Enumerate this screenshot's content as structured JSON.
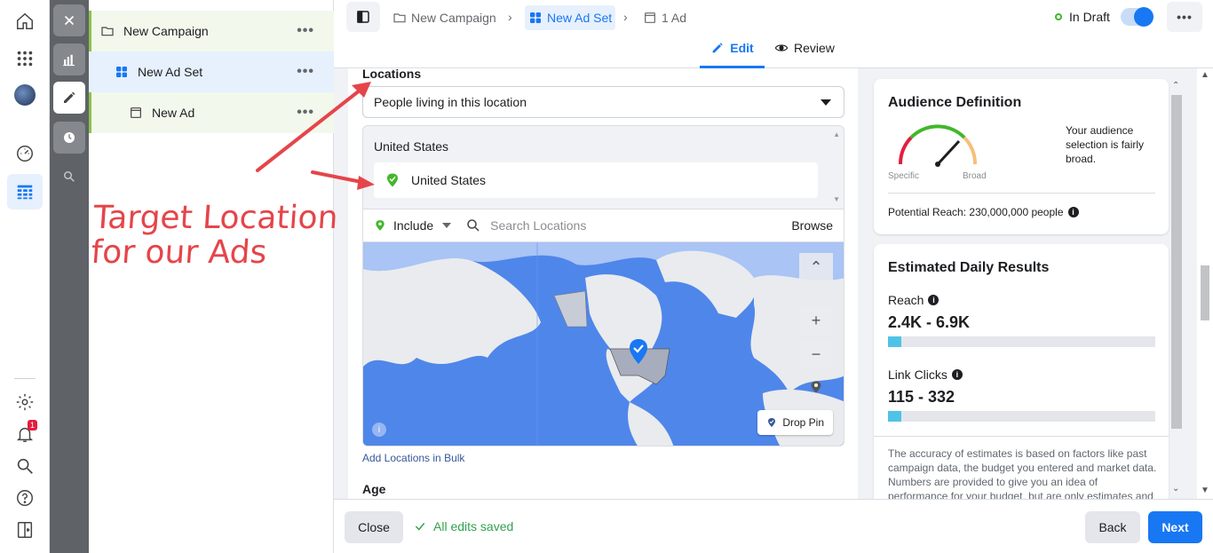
{
  "tree": {
    "campaign": "New Campaign",
    "adset": "New Ad Set",
    "ad": "New Ad",
    "more": "•••"
  },
  "breadcrumb": {
    "campaign": "New Campaign",
    "adset": "New Ad Set",
    "ad": "1 Ad"
  },
  "header": {
    "status": "In Draft",
    "tabs": {
      "edit": "Edit",
      "review": "Review"
    },
    "more": "•••"
  },
  "notifications": {
    "count": "1"
  },
  "locations": {
    "title": "Locations",
    "select_value": "People living in this location",
    "group_heading": "United States",
    "selected": [
      "United States"
    ],
    "include_label": "Include",
    "search_placeholder": "Search Locations",
    "browse": "Browse",
    "drop_pin": "Drop Pin",
    "bulk_link": "Add Locations in Bulk"
  },
  "age": {
    "title": "Age"
  },
  "audience": {
    "title": "Audience Definition",
    "gauge_left": "Specific",
    "gauge_right": "Broad",
    "description": "Your audience selection is fairly broad.",
    "potential_reach": "Potential Reach: 230,000,000 people"
  },
  "daily": {
    "title": "Estimated Daily Results",
    "reach_label": "Reach",
    "reach_value": "2.4K - 6.9K",
    "reach_fill": 0.05,
    "clicks_label": "Link Clicks",
    "clicks_value": "115 - 332",
    "clicks_fill": 0.05,
    "disclaimer": "The accuracy of estimates is based on factors like past campaign data, the budget you entered and market data. Numbers are provided to give you an idea of performance for your budget, but are only estimates and"
  },
  "footer": {
    "close": "Close",
    "saved": "All edits saved",
    "back": "Back",
    "next": "Next"
  },
  "annotation": {
    "line1": "Target Location",
    "line2": "for our Ads"
  },
  "colors": {
    "accent": "#1877f2",
    "draft_green": "#42b72a",
    "annotation_red": "#e5454a",
    "progress": "#4fc3e6"
  }
}
